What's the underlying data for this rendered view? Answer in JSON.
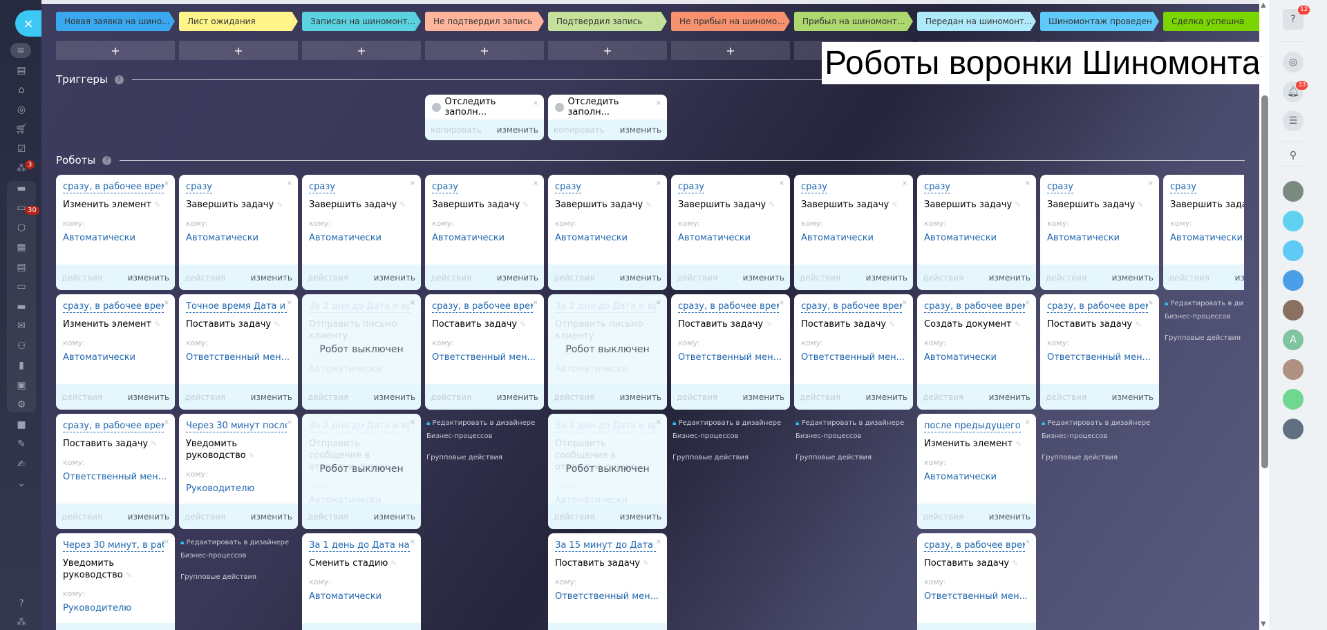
{
  "overlay_title": "Роботы воронки Шиномонтаж",
  "sections": {
    "triggers": "Триггеры",
    "robots": "Роботы",
    "help": "?"
  },
  "labels": {
    "to": "кому:",
    "actions": "действия",
    "edit": "изменить",
    "copy": "копировать",
    "disabled": "Робот выключен",
    "designer": "Редактировать в дизайнере Бизнес-процессов",
    "group": "Групповые действия",
    "plus": "+",
    "close": "×"
  },
  "leftbar": {
    "badges": {
      "tasks": "3",
      "chats": "30"
    }
  },
  "rightbar": {
    "help_badge": "12",
    "notify_badge": "33",
    "avatar_letter": "A"
  },
  "columns": [
    {
      "stage": "Новая заявка на шино...",
      "color": "#39a8ef",
      "triggers": [],
      "robots": [
        {
          "delay": "сразу, в рабочее врем...",
          "name": "Изменить элемент",
          "to": "Автоматически"
        },
        {
          "delay": "сразу, в рабочее время",
          "name": "Изменить элемент",
          "to": "Автоматически"
        },
        {
          "delay": "сразу, в рабочее врем...",
          "name": "Поставить задачу",
          "to": "Ответственный мен..."
        },
        {
          "delay": "Через 30 минут, в раб...",
          "name": "Уведомить руководство",
          "to": "Руководителю"
        }
      ]
    },
    {
      "stage": "Лист ожидания",
      "color": "#fff48a",
      "triggers": [],
      "robots": [
        {
          "delay": "сразу",
          "name": "Завершить задачу",
          "to": "Автоматически"
        },
        {
          "delay": "Точное время Дата и ...",
          "name": "Поставить задачу",
          "to": "Ответственный мен..."
        },
        {
          "delay": "Через 30 минут после...",
          "name": "Уведомить руководство",
          "to": "Руководителю"
        },
        {
          "links": true
        }
      ]
    },
    {
      "stage": "Записан на шиномонт...",
      "color": "#5bd2e0",
      "triggers": [],
      "robots": [
        {
          "delay": "сразу",
          "name": "Завершить задачу",
          "to": "Автоматически"
        },
        {
          "delay": "За 2 дня до Дата и вре...",
          "name": "Отправить письмо клиенту",
          "to": "Автоматически",
          "off": true
        },
        {
          "delay": "За 2 дня до Дата и вре...",
          "name": "Отправить сообщение в открытую линию",
          "to": "Автоматически",
          "off": true
        },
        {
          "delay": "За 1 день до Дата нач...",
          "name": "Сменить стадию",
          "to": "Автоматически"
        }
      ]
    },
    {
      "stage": "Не подтвердил запись",
      "color": "#ffb59c",
      "triggers": [
        "Отследить заполн..."
      ],
      "robots": [
        {
          "delay": "сразу",
          "name": "Завершить задачу",
          "to": "Автоматически"
        },
        {
          "delay": "сразу, в рабочее время",
          "name": "Поставить задачу",
          "to": "Ответственный мен..."
        },
        {
          "links": true
        }
      ]
    },
    {
      "stage": "Подтвердил запись",
      "color": "#c4e09a",
      "triggers": [
        "Отследить заполн..."
      ],
      "robots": [
        {
          "delay": "сразу",
          "name": "Завершить задачу",
          "to": "Автоматически"
        },
        {
          "delay": "За 2 дня до Дата и вре...",
          "name": "Отправить письмо клиенту",
          "to": "Автоматически",
          "off": true
        },
        {
          "delay": "За 2 дня до Дата и вре...",
          "name": "Отправить сообщение в открытую линию",
          "to": "Автоматически",
          "off": true
        },
        {
          "delay": "За 15 минут до Дата и...",
          "name": "Поставить задачу",
          "to": "Ответственный мен..."
        }
      ]
    },
    {
      "stage": "Не прибыл на шиномо...",
      "color": "#f7916e",
      "triggers": [],
      "robots": [
        {
          "delay": "сразу",
          "name": "Завершить задачу",
          "to": "Автоматически"
        },
        {
          "delay": "сразу, в рабочее время",
          "name": "Поставить задачу",
          "to": "Ответственный мен..."
        },
        {
          "links": true
        }
      ]
    },
    {
      "stage": "Прибыл на шиномонт...",
      "color": "#acd86d",
      "triggers": [],
      "robots": [
        {
          "delay": "сразу",
          "name": "Завершить задачу",
          "to": "Автоматически"
        },
        {
          "delay": "сразу, в рабочее время",
          "name": "Поставить задачу",
          "to": "Ответственный мен..."
        },
        {
          "links": true
        }
      ]
    },
    {
      "stage": "Передан на шиномонт...",
      "color": "#aeeaf9",
      "triggers": [],
      "robots": [
        {
          "delay": "сразу",
          "name": "Завершить задачу",
          "to": "Автоматически"
        },
        {
          "delay": "сразу, в рабочее время",
          "name": "Создать документ",
          "to": "Автоматически"
        },
        {
          "delay": "после предыдущего",
          "name": "Изменить элемент",
          "to": "Автоматически"
        },
        {
          "delay": "сразу, в рабочее врем...",
          "name": "Поставить задачу",
          "to": "Ответственный мен..."
        }
      ]
    },
    {
      "stage": "Шиномонтаж проведен",
      "color": "#5fcaf9",
      "triggers": [],
      "robots": [
        {
          "delay": "сразу",
          "name": "Завершить задачу",
          "to": "Автоматически"
        },
        {
          "delay": "сразу, в рабочее время",
          "name": "Поставить задачу",
          "to": "Ответственный мен..."
        },
        {
          "links": true
        }
      ]
    },
    {
      "stage": "Сделка успешна",
      "color": "#7bd500",
      "triggers": [],
      "robots": [
        {
          "delay": "сразу",
          "name": "Завершить задачу",
          "to": "Автоматически"
        },
        {
          "links": true
        }
      ]
    }
  ]
}
